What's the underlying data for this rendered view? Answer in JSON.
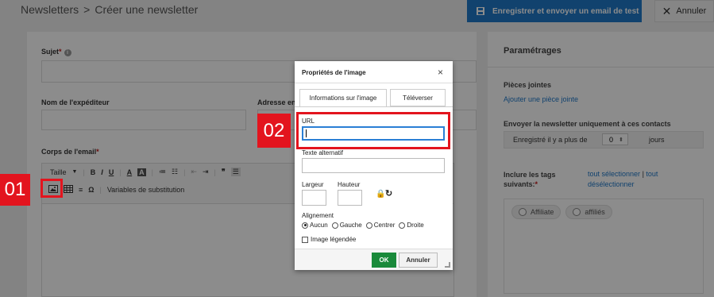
{
  "breadcrumb": {
    "parent": "Newsletters",
    "separator": ">",
    "current": "Créer une newsletter"
  },
  "header": {
    "save_label": "Enregistrer et envoyer un email de test",
    "cancel_label": "Annuler"
  },
  "form": {
    "subject_label": "Sujet",
    "sender_name_label": "Nom de l'expéditeur",
    "address_label": "Adresse en",
    "body_label": "Corps de l'email"
  },
  "toolbar": {
    "style_label": "Taille",
    "variables_label": "Variables de substitution"
  },
  "settings": {
    "title": "Paramétrages",
    "attachments_title": "Pièces jointes",
    "attachments_link": "Ajouter une pièce jointe",
    "send_only_label": "Envoyer la newsletter uniquement à ces contacts",
    "registered_prefix": "Enregistré il y a plus de",
    "days_value": "0",
    "days_label": "jours",
    "include_tags_label": "Inclure les tags suivants:",
    "select_all": "tout sélectionner",
    "separator": "|",
    "deselect_all": "tout désélectionner",
    "tags": [
      "Affiliate",
      "affiliés"
    ]
  },
  "callouts": {
    "first": "01",
    "second": "02"
  },
  "dialog": {
    "title": "Propriétés de l'image",
    "close": "×",
    "tab_info": "Informations sur l'image",
    "tab_upload": "Téléverser",
    "url_label": "URL",
    "url_value": "",
    "alt_label": "Texte alternatif",
    "width_label": "Largeur",
    "height_label": "Hauteur",
    "alignment_label": "Alignement",
    "alignment_options": [
      "Aucun",
      "Gauche",
      "Centrer",
      "Droite"
    ],
    "selected_alignment": "Aucun",
    "caption_label": "Image légendée",
    "ok_label": "OK",
    "cancel_label": "Annuler"
  }
}
